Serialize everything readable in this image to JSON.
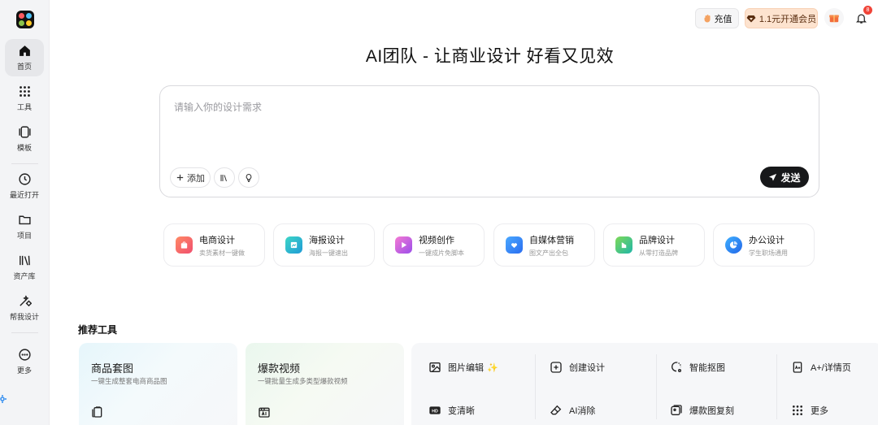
{
  "sidebar": {
    "items": [
      {
        "label": "首页",
        "icon": "home-icon",
        "active": true
      },
      {
        "label": "工具",
        "icon": "grid-dots-icon"
      },
      {
        "label": "模板",
        "icon": "template-icon"
      },
      {
        "label": "最近打开",
        "icon": "clock-icon"
      },
      {
        "label": "项目",
        "icon": "folder-icon"
      },
      {
        "label": "资产库",
        "icon": "library-icon"
      },
      {
        "label": "帮我设计",
        "icon": "magic-wand-icon"
      },
      {
        "label": "更多",
        "icon": "more-circle-icon"
      }
    ]
  },
  "topbar": {
    "recharge_label": "充值",
    "vip_label": "1.1元开通会员",
    "notification_count": "8"
  },
  "hero": {
    "title": "AI团队 - 让商业设计 好看又见效",
    "prompt_placeholder": "请输入你的设计需求",
    "add_label": "添加",
    "send_label": "发送"
  },
  "categories": [
    {
      "title": "电商设计",
      "subtitle": "卖货素材一键做",
      "color": "#f26d5b"
    },
    {
      "title": "海报设计",
      "subtitle": "海报一键速出",
      "color": "#22b8c7"
    },
    {
      "title": "视频创作",
      "subtitle": "一键成片免脚本",
      "color": "#c354e6"
    },
    {
      "title": "自媒体营销",
      "subtitle": "图文产出全包",
      "color": "#2f8cf0"
    },
    {
      "title": "品牌设计",
      "subtitle": "从零打造品牌",
      "color": "#3fc86b"
    },
    {
      "title": "办公设计",
      "subtitle": "学生职场通用",
      "color": "#2f8cf0"
    }
  ],
  "recommended": {
    "title": "推荐工具",
    "cards": [
      {
        "title": "商品套图",
        "subtitle": "一键生成整套电商商品图"
      },
      {
        "title": "爆款视频",
        "subtitle": "一键批量生成多类型爆款视频"
      }
    ],
    "tools": [
      {
        "label": "图片编辑",
        "icon": "image-icon"
      },
      {
        "label": "创建设计",
        "icon": "plus-square-icon"
      },
      {
        "label": "智能抠图",
        "icon": "cutout-icon"
      },
      {
        "label": "A+/详情页",
        "icon": "detail-page-icon"
      },
      {
        "label": "变清晰",
        "icon": "hd-icon"
      },
      {
        "label": "AI消除",
        "icon": "eraser-icon"
      },
      {
        "label": "爆款图复刻",
        "icon": "copy-image-icon"
      },
      {
        "label": "更多",
        "icon": "grid-dots-icon"
      }
    ]
  }
}
